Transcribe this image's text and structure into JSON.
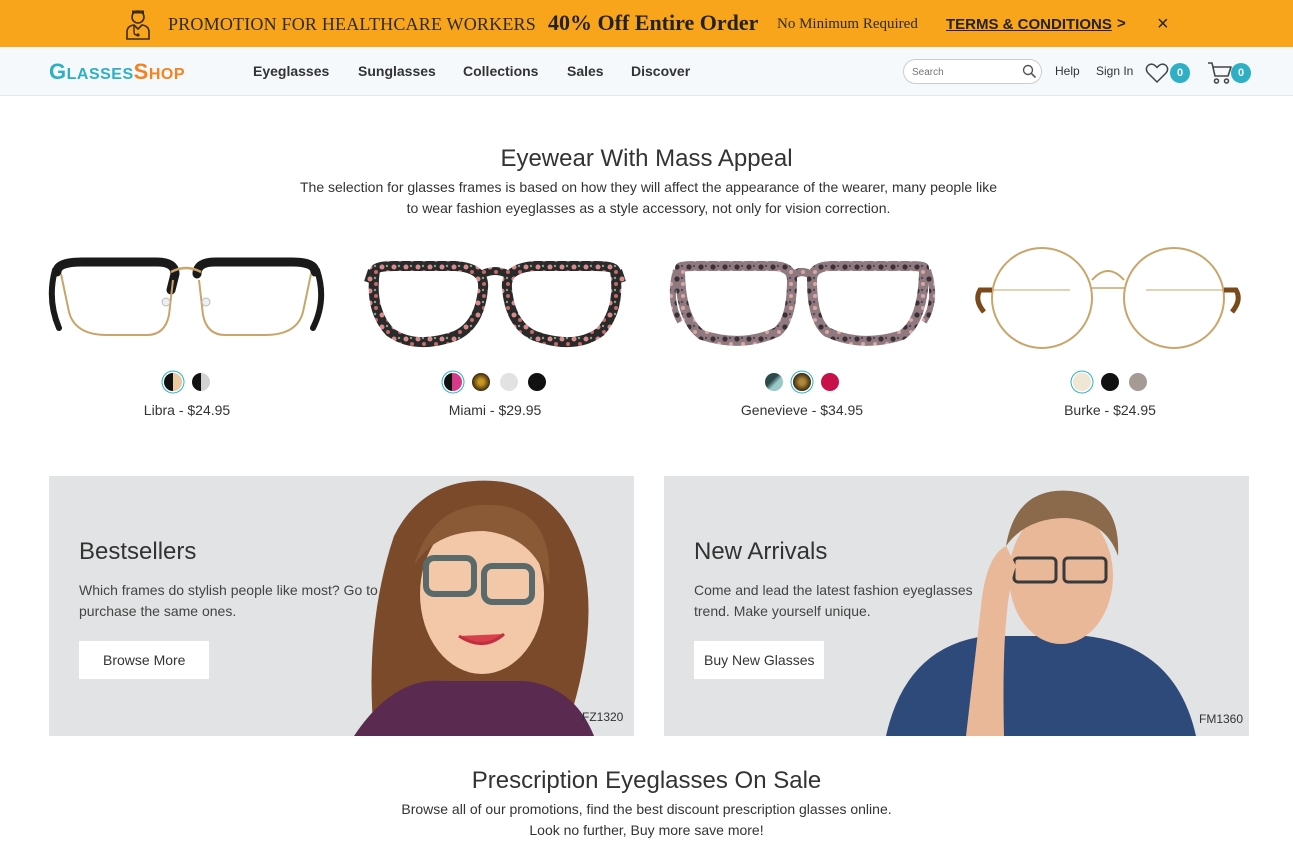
{
  "promo": {
    "headline": "PROMOTION FOR HEALTHCARE WORKERS",
    "offer": "40% Off Entire Order",
    "minimum": "No Minimum Required",
    "terms": "TERMS & CONDITIONS",
    "terms_arrow": ">",
    "close": "×",
    "icon": "doctor-icon",
    "color": "#f8a51b"
  },
  "header": {
    "logo": {
      "part1_big": "G",
      "part1_small": "LASSES",
      "part2_big": "S",
      "part2_small": "HOP"
    },
    "nav": [
      "Eyeglasses",
      "Sunglasses",
      "Collections",
      "Sales",
      "Discover"
    ],
    "search_placeholder": "Search",
    "help": "Help",
    "sign_in": "Sign In",
    "wishlist_count": "0",
    "cart_count": "0",
    "accent": "#2eafc4"
  },
  "hero": {
    "title": "Eyewear With Mass Appeal",
    "desc_line1": "The selection for glasses frames is based on how they will affect the appearance of the wearer, many people like",
    "desc_line2": "to wear fashion eyeglasses as a style accessory, not only for vision correction."
  },
  "products": [
    {
      "name": "Libra - $24.95",
      "swatches": [
        "#e8c9a0",
        "#9a9a9a"
      ],
      "active": 0
    },
    {
      "name": "Miami - $29.95",
      "swatches": [
        "#d83a8a",
        "#6b4a1a",
        "#e2e2e2",
        "#111111"
      ],
      "active": 0
    },
    {
      "name": "Genevieve - $34.95",
      "swatches": [
        "#5a8a8a",
        "#5c4420",
        "#c8104a"
      ],
      "active": 1
    },
    {
      "name": "Burke - $24.95",
      "swatches": [
        "#f0e6d4",
        "#111111",
        "#a59b95"
      ],
      "active": 0
    }
  ],
  "cards": [
    {
      "title": "Bestsellers",
      "desc": "Which frames do stylish people like most? Go to purchase the same ones.",
      "button": "Browse More",
      "code": "FZ1320"
    },
    {
      "title": "New Arrivals",
      "desc": "Come and lead the latest fashion eyeglasses trend. Make yourself unique.",
      "button": "Buy New Glasses",
      "code": "FM1360"
    }
  ],
  "sale": {
    "title": "Prescription Eyeglasses On Sale",
    "line1": "Browse all of our promotions, find the best discount prescription glasses online.",
    "line2": "Look no further, Buy more save more!"
  }
}
